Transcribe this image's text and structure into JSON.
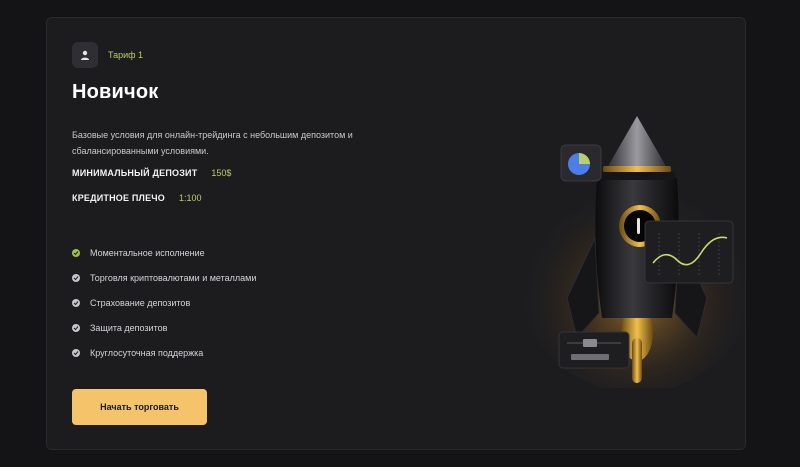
{
  "tier": {
    "label": "Тариф 1",
    "icon": "user-icon"
  },
  "title": "Новичок",
  "description": "Базовые условия для онлайн-трейдинга с небольшим депозитом и сбалансированными условиями.",
  "specs": [
    {
      "label": "МИНИМАЛЬНЫЙ ДЕПОЗИТ",
      "value": "150$"
    },
    {
      "label": "КРЕДИТНОЕ ПЛЕЧО",
      "value": "1:100"
    }
  ],
  "features": [
    {
      "label": "Моментальное исполнение",
      "highlight": true
    },
    {
      "label": "Торговля криптовалютами и металлами",
      "highlight": false
    },
    {
      "label": "Страхование депозитов",
      "highlight": false
    },
    {
      "label": "Защита депозитов",
      "highlight": false
    },
    {
      "label": "Круглосуточная поддержка",
      "highlight": false
    }
  ],
  "cta": {
    "label": "Начать торговать"
  },
  "colors": {
    "accent_green": "#b8cf6a",
    "check_green": "#9fc04a",
    "button": "#f5c36a",
    "card_bg": "#1c1c1f",
    "page_bg": "#141416"
  }
}
